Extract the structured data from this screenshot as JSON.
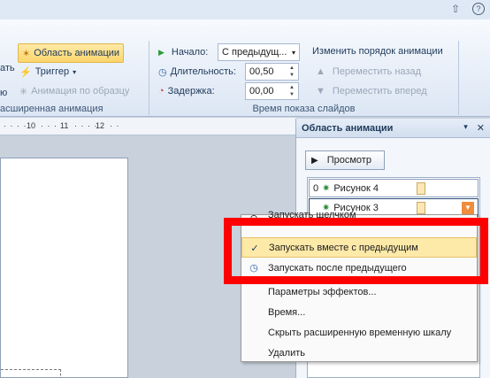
{
  "window": {
    "icons": [
      "up-arrow-icon",
      "help-icon"
    ]
  },
  "ribbon": {
    "advanced": {
      "animation_pane": "Область анимации",
      "trigger": "Триггер",
      "animation_painter": "Анимация по образцу",
      "left_cut_1": "ать",
      "left_cut_2": "ю",
      "group_title": "асширенная анимация"
    },
    "timing": {
      "start_label": "Начало:",
      "start_value": "С предыдущ...",
      "duration_label": "Длительность:",
      "duration_value": "00,50",
      "delay_label": "Задержка:",
      "delay_value": "00,00",
      "reorder_label": "Изменить порядок анимации",
      "move_earlier": "Переместить назад",
      "move_later": "Переместить вперед",
      "group_title": "Время показа слайдов"
    }
  },
  "ruler": {
    "ticks": [
      "10",
      "11",
      "12"
    ]
  },
  "pane": {
    "title": "Область анимации",
    "play_button": "Просмотр",
    "items": [
      {
        "index": "0",
        "label": "Рисунок 4"
      },
      {
        "index": "",
        "label": "Рисунок 3"
      }
    ]
  },
  "context_menu": {
    "items": [
      {
        "label": "Запускать щелчком",
        "icon": "mouse-icon"
      },
      {
        "label": "Запускать вместе с предыдущим",
        "icon": "check-icon",
        "highlighted": true
      },
      {
        "label": "Запускать после предыдущего",
        "icon": "clock-icon"
      },
      {
        "label": "Параметры эффектов..."
      },
      {
        "label": "Время..."
      },
      {
        "label": "Скрыть расширенную временную шкалу"
      },
      {
        "label": "Удалить"
      }
    ]
  },
  "colors": {
    "highlight": "#fde9a8",
    "annotation_box": "#ff0000",
    "accent_orange": "#f08c3c"
  }
}
